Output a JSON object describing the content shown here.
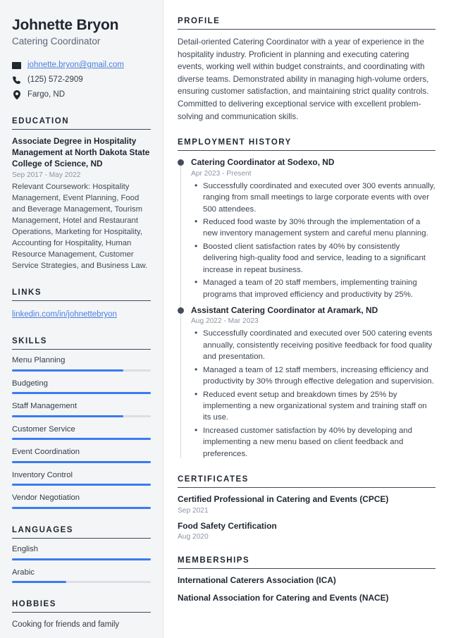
{
  "person": {
    "name": "Johnette Bryon",
    "title": "Catering Coordinator",
    "email": "johnette.bryon@gmail.com",
    "phone": "(125) 572-2909",
    "location": "Fargo, ND"
  },
  "colors": {
    "accent": "#3a7bf0",
    "link": "#4a7fe0",
    "heading": "#1f2630",
    "muted": "#8d94a0",
    "sidebar_bg": "#f4f5f7",
    "rule": "#41485a"
  },
  "sections": {
    "education": "Education",
    "links": "Links",
    "skills": "Skills",
    "languages": "Languages",
    "hobbies": "Hobbies",
    "profile": "Profile",
    "employment": "Employment History",
    "certificates": "Certificates",
    "memberships": "Memberships"
  },
  "education": [
    {
      "title": "Associate Degree in Hospitality Management at North Dakota State College of Science, ND",
      "date": "Sep 2017 - May 2022",
      "description": "Relevant Coursework: Hospitality Management, Event Planning, Food and Beverage Management, Tourism Management, Hotel and Restaurant Operations, Marketing for Hospitality, Accounting for Hospitality, Human Resource Management, Customer Service Strategies, and Business Law."
    }
  ],
  "links": [
    {
      "label": "linkedin.com/in/johnettebryon"
    }
  ],
  "skills": [
    {
      "label": "Menu Planning",
      "level": 80
    },
    {
      "label": "Budgeting",
      "level": 100
    },
    {
      "label": "Staff Management",
      "level": 80
    },
    {
      "label": "Customer Service",
      "level": 100
    },
    {
      "label": "Event Coordination",
      "level": 100
    },
    {
      "label": "Inventory Control",
      "level": 100
    },
    {
      "label": "Vendor Negotiation",
      "level": 100
    }
  ],
  "languages": [
    {
      "label": "English",
      "level": 100
    },
    {
      "label": "Arabic",
      "level": 39
    }
  ],
  "hobbies": [
    {
      "text": "Cooking for friends and family"
    }
  ],
  "profile": {
    "text": "Detail-oriented Catering Coordinator with a year of experience in the hospitality industry. Proficient in planning and executing catering events, working well within budget constraints, and coordinating with diverse teams. Demonstrated ability in managing high-volume orders, ensuring customer satisfaction, and maintaining strict quality controls. Committed to delivering exceptional service with excellent problem-solving and communication skills."
  },
  "employment": [
    {
      "title": "Catering Coordinator at Sodexo, ND",
      "date": "Apr 2023 - Present",
      "bullets": [
        "Successfully coordinated and executed over 300 events annually, ranging from small meetings to large corporate events with over 500 attendees.",
        "Reduced food waste by 30% through the implementation of a new inventory management system and careful menu planning.",
        "Boosted client satisfaction rates by 40% by consistently delivering high-quality food and service, leading to a significant increase in repeat business.",
        "Managed a team of 20 staff members, implementing training programs that improved efficiency and productivity by 25%."
      ]
    },
    {
      "title": "Assistant Catering Coordinator at Aramark, ND",
      "date": "Aug 2022 - Mar 2023",
      "bullets": [
        "Successfully coordinated and executed over 500 catering events annually, consistently receiving positive feedback for food quality and presentation.",
        "Managed a team of 12 staff members, increasing efficiency and productivity by 30% through effective delegation and supervision.",
        "Reduced event setup and breakdown times by 25% by implementing a new organizational system and training staff on its use.",
        "Increased customer satisfaction by 40% by developing and implementing a new menu based on client feedback and preferences."
      ]
    }
  ],
  "certificates": [
    {
      "name": "Certified Professional in Catering and Events (CPCE)",
      "date": "Sep 2021"
    },
    {
      "name": "Food Safety Certification",
      "date": "Aug 2020"
    }
  ],
  "memberships": [
    {
      "name": "International Caterers Association (ICA)"
    },
    {
      "name": "National Association for Catering and Events (NACE)"
    }
  ]
}
